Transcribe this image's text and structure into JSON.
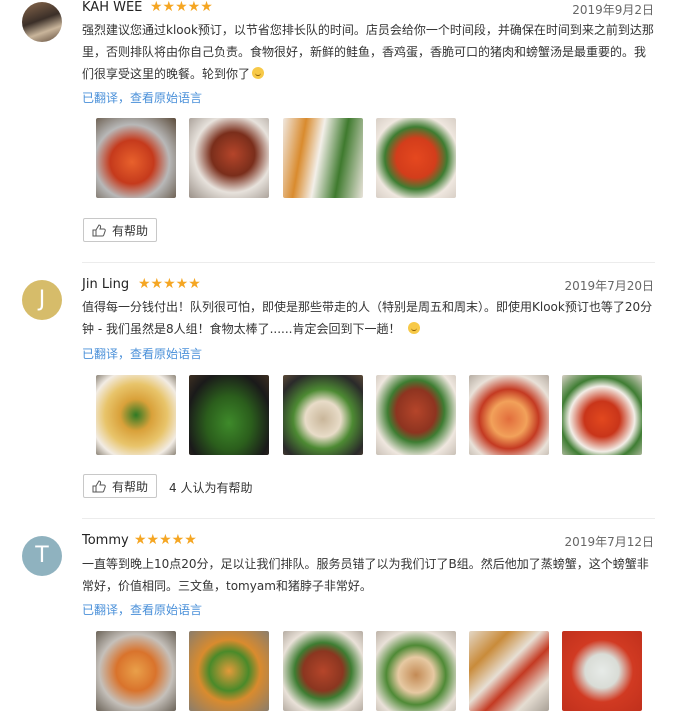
{
  "reviews": [
    {
      "name": "KAH WEE",
      "stars": "★★★★★",
      "date": "2019年9月2日",
      "text": "强烈建议您通过klook预订，以节省您排长队的时间。店员会给你一个时间段，并确保在时间到来之前到达那里，否则排队将由你自己负责。食物很好，新鲜的鲑鱼，香鸡蛋，香脆可口的猪肉和螃蟹汤是最重要的。我们很享受这里的晚餐。轮到你了",
      "translated": "已翻译，查看原始语言",
      "helpful_label": "有帮助",
      "helpful_count": ""
    },
    {
      "name": "Jin Ling",
      "avatar_letter": "J",
      "stars": "★★★★★",
      "date": "2019年7月20日",
      "text": "值得每一分钱付出！队列很可怕，即使是那些带走的人（特别是周五和周末）。即使用Klook预订也等了20分钟 - 我们虽然是8人组！食物太棒了......肯定会回到下一趟！",
      "translated": "已翻译，查看原始语言",
      "helpful_label": "有帮助",
      "helpful_count": "4 人认为有帮助"
    },
    {
      "name": "Tommy",
      "avatar_letter": "T",
      "stars": "★★★★★",
      "date": "2019年7月12日",
      "text": "一直等到晚上10点20分，足以让我们排队。服务员错了以为我们订了B组。然后他加了蒸螃蟹，这个螃蟹非常好，价值相同。三文鱼，tomyam和猪脖子非常好。",
      "translated": "已翻译，查看原始语言",
      "helpful_label": "有帮助",
      "helpful_count": ""
    }
  ],
  "colors": {
    "star": "#f5a623",
    "link": "#4a90d9",
    "avatar_j": "#d6bc6a",
    "avatar_t": "#8fb2bf"
  },
  "icons": {
    "helpful": "thumbs-up-icon"
  }
}
